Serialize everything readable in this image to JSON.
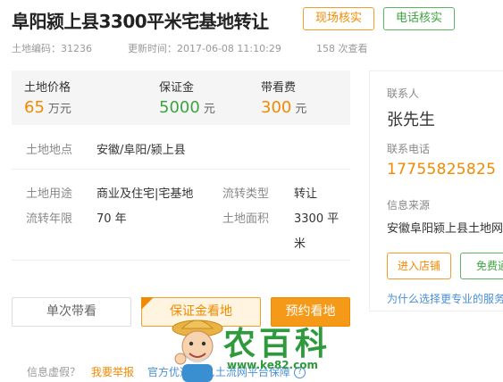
{
  "header": {
    "title": "阜阳颍上县3300平米宅基地转让",
    "verify_site_label": "现场核实",
    "verify_phone_label": "电话核实"
  },
  "meta": {
    "code": "土地编码：31236",
    "updated": "更新时间：2017-06-08 11:10:29",
    "views": "158 次查看"
  },
  "prices": [
    {
      "label": "土地价格",
      "value": "65",
      "unit": "万元",
      "color": "#f08a00"
    },
    {
      "label": "保证金",
      "value": "5000",
      "unit": "元",
      "color": "#3ea341"
    },
    {
      "label": "带看费",
      "value": "300",
      "unit": "元",
      "color": "#f08a00"
    }
  ],
  "details": {
    "location_label": "土地地点",
    "location_value": "安徽/阜阳/颍上县",
    "use_label": "土地用途",
    "use_value": "商业及住宅|宅基地",
    "transfer_type_label": "流转类型",
    "transfer_type_value": "转让",
    "years_label": "流转年限",
    "years_value": "70 年",
    "area_label": "土地面积",
    "area_value_1": "3300 平",
    "area_value_2": "米"
  },
  "actions": {
    "single_view": "单次带看",
    "deposit_view": "保证金看地",
    "book_view": "预约看地"
  },
  "contact": {
    "contact_label": "联系人",
    "contact_name": "张先生",
    "phone_label": "联系电话",
    "phone": "17755825825",
    "source_label": "信息来源",
    "source": "安徽阜阳颍上县土地网",
    "store_button": "进入店铺",
    "free_button": "免费通",
    "why_link": "为什么选择更专业的服务"
  },
  "footer": {
    "false_info": "信息虚假？",
    "report": "我要举报",
    "official": "官方优选渠道,土流网平台保障",
    "help_icon": "?"
  },
  "watermark": {
    "brand": "农百科",
    "url": "www.ke82.com"
  },
  "colors": {
    "accent_orange": "#f08a00",
    "accent_green": "#3ea341",
    "link_blue": "#4a90d9"
  }
}
